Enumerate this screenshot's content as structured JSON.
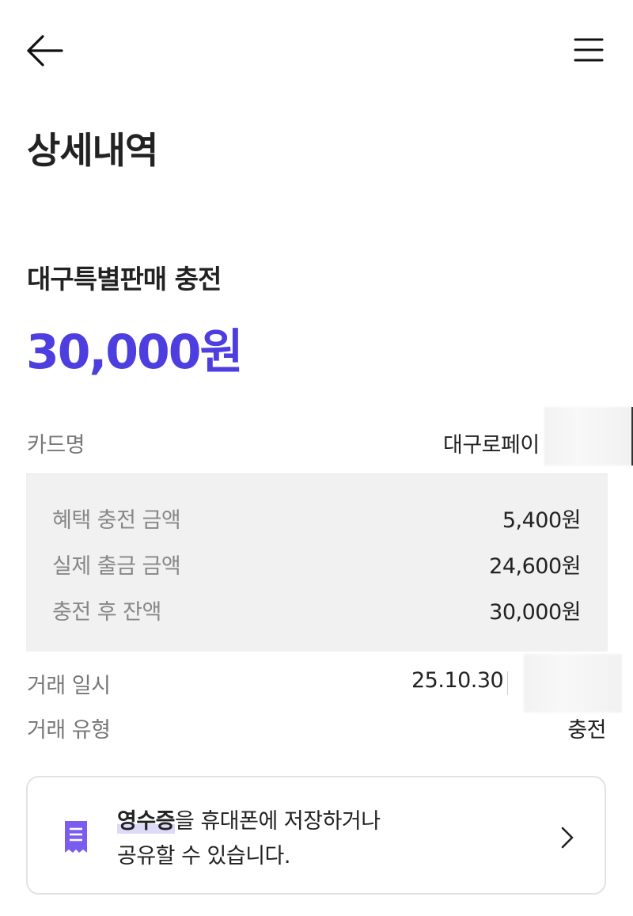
{
  "header": {
    "back_icon": "arrow-left-icon",
    "menu_icon": "hamburger-menu-icon",
    "page_title": "상세내역"
  },
  "transaction": {
    "title": "대구특별판매 충전",
    "amount": "30,000원",
    "amount_color": "#4d3ee0"
  },
  "details": {
    "card_name_label": "카드명",
    "card_name_value": "대구로페이",
    "breakdown": [
      {
        "label": "혜택 충전 금액",
        "value": "5,400원"
      },
      {
        "label": "실제 출금 금액",
        "value": "24,600원"
      },
      {
        "label": "충전 후 잔액",
        "value": "30,000원"
      }
    ],
    "datetime_label": "거래 일시",
    "datetime_value": "25.10.30",
    "type_label": "거래 유형",
    "type_value": "충전"
  },
  "receipt": {
    "icon": "receipt-icon",
    "icon_color": "#7b5cf0",
    "highlight": "영수증",
    "line1_rest": "을 휴대폰에 저장하거나",
    "line2": "공유할 수 있습니다.",
    "chevron_icon": "chevron-right-icon"
  }
}
